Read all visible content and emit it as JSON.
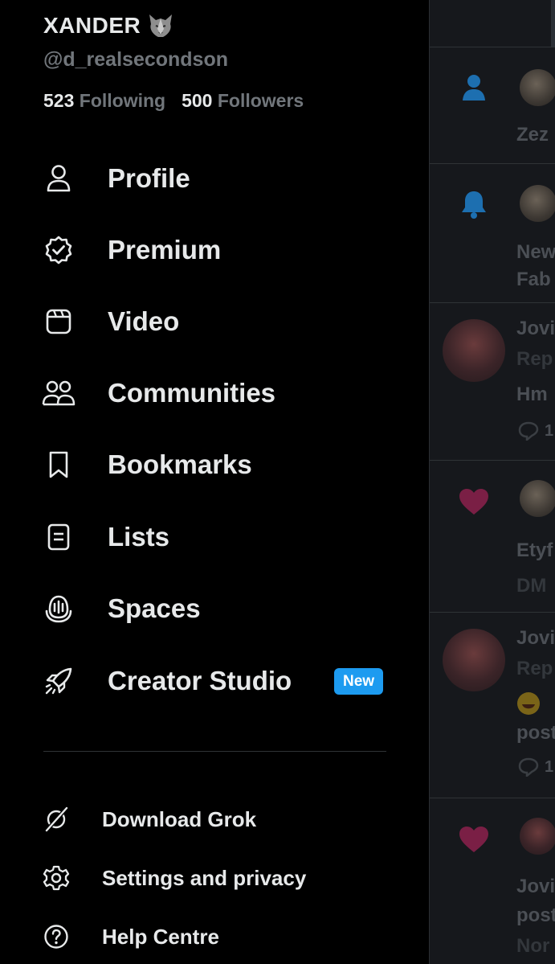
{
  "profile": {
    "display_name": "XANDER",
    "handle": "@d_realsecondson",
    "following_count": "523",
    "following_label": "Following",
    "followers_count": "500",
    "followers_label": "Followers"
  },
  "menu": {
    "profile": "Profile",
    "premium": "Premium",
    "video": "Video",
    "communities": "Communities",
    "bookmarks": "Bookmarks",
    "lists": "Lists",
    "spaces": "Spaces",
    "creator_studio": "Creator Studio",
    "creator_studio_badge": "New"
  },
  "secondary_menu": {
    "download_grok": "Download Grok",
    "settings": "Settings and privacy",
    "help": "Help Centre"
  },
  "background_timeline": {
    "n1_text": "Zez",
    "n2_line1": "New",
    "n2_line2": "Fab",
    "n3_name": "Jovi",
    "n3_sub": "Rep",
    "n3_body": "Hm",
    "n3_count": "1",
    "n4_name": "Etyf",
    "n4_sub": "DM",
    "n5_name": "Jovi",
    "n5_sub": "Rep",
    "n5_body": "post",
    "n5_count": "1",
    "n6_name": "Jovi",
    "n6_sub": "post",
    "n6_sub2": "Nor"
  },
  "colors": {
    "accent": "#1d9bf0",
    "text_primary": "#e7e9ea",
    "text_secondary": "#71767b",
    "like_heart": "#c0306a"
  }
}
